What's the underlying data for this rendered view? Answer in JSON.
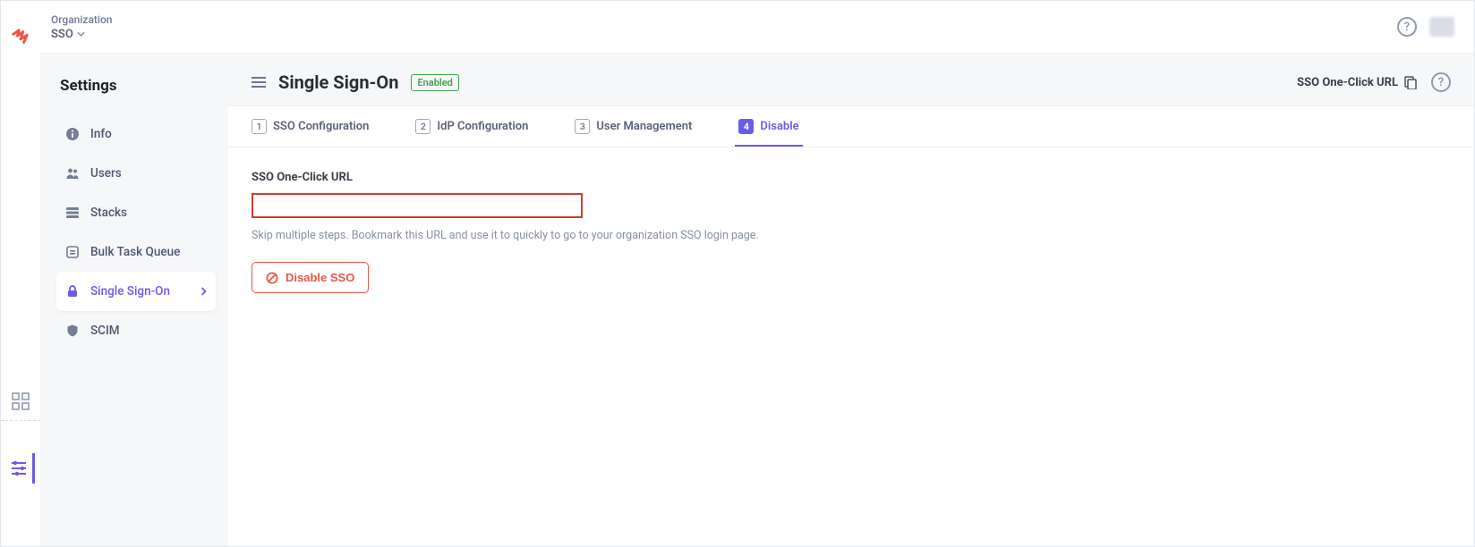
{
  "breadcrumb": {
    "top": "Organization",
    "bottom": "SSO"
  },
  "sidebar": {
    "title": "Settings",
    "items": [
      {
        "icon": "info",
        "label": "Info"
      },
      {
        "icon": "users",
        "label": "Users"
      },
      {
        "icon": "stacks",
        "label": "Stacks"
      },
      {
        "icon": "queue",
        "label": "Bulk Task Queue"
      },
      {
        "icon": "lock",
        "label": "Single Sign-On"
      },
      {
        "icon": "shield",
        "label": "SCIM"
      }
    ]
  },
  "page": {
    "title": "Single Sign-On",
    "status": "Enabled",
    "header_link": "SSO One-Click URL"
  },
  "tabs": [
    {
      "num": "1",
      "label": "SSO Configuration"
    },
    {
      "num": "2",
      "label": "IdP Configuration"
    },
    {
      "num": "3",
      "label": "User Management"
    },
    {
      "num": "4",
      "label": "Disable"
    }
  ],
  "form": {
    "url_label": "SSO One-Click URL",
    "url_value": "",
    "url_help": "Skip multiple steps. Bookmark this URL and use it to quickly to go to your organization SSO login page.",
    "disable_button": "Disable SSO"
  }
}
